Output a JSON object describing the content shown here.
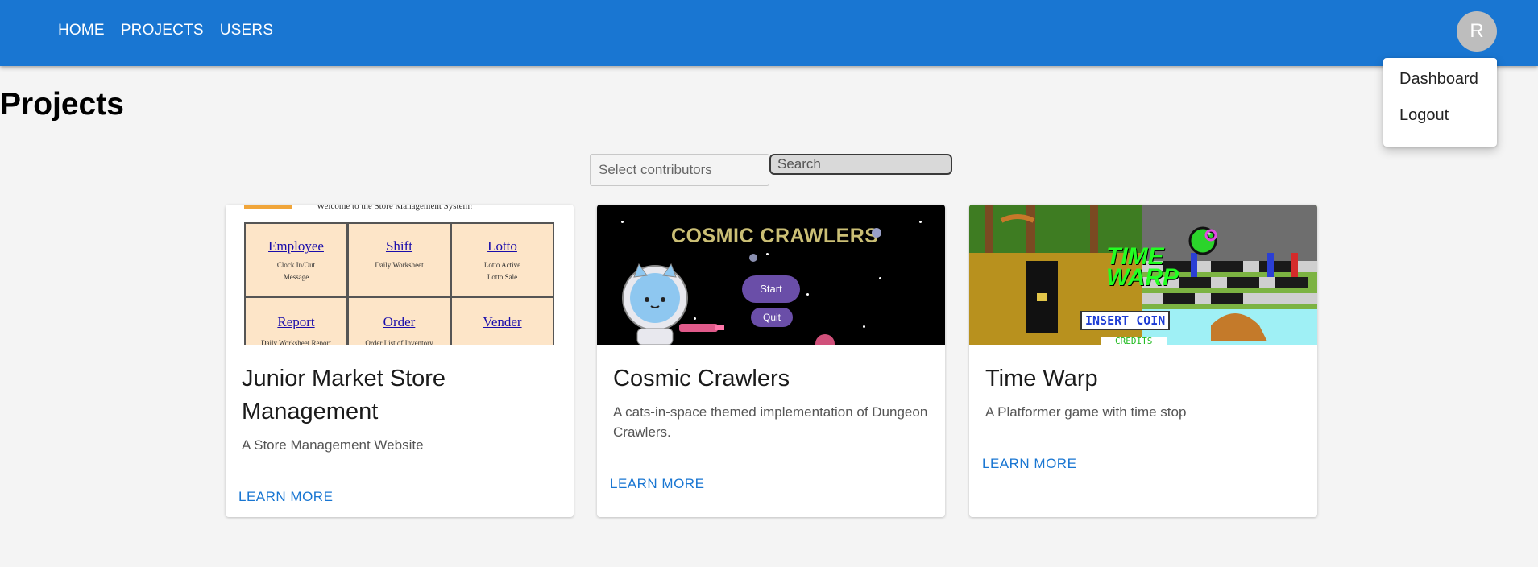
{
  "nav": {
    "home": "HOME",
    "projects": "PROJECTS",
    "users": "USERS"
  },
  "avatar_letter": "R",
  "menu": {
    "dashboard": "Dashboard",
    "logout": "Logout"
  },
  "page_title": "Projects",
  "filters": {
    "contributors_placeholder": "Select contributors",
    "search_placeholder": "Search"
  },
  "cards": [
    {
      "title": "Junior Market Store Management",
      "description": "A Store Management Website",
      "action": "LEARN MORE",
      "thumbnail": {
        "welcome": "Welcome to the Store Management System!",
        "cells": [
          {
            "link": "Employee",
            "sub1": "Clock In/Out",
            "sub2": "Message"
          },
          {
            "link": "Shift",
            "sub1": "Daily Worksheet",
            "sub2": ""
          },
          {
            "link": "Lotto",
            "sub1": "Lotto Active",
            "sub2": "Lotto Sale"
          },
          {
            "link": "Report",
            "sub1": "Daily Worksheet Report",
            "sub2": ""
          },
          {
            "link": "Order",
            "sub1": "Order List of Inventory",
            "sub2": ""
          },
          {
            "link": "Vender",
            "sub1": "",
            "sub2": ""
          }
        ]
      }
    },
    {
      "title": "Cosmic Crawlers",
      "description": "A cats-in-space themed implementation of Dungeon Crawlers.",
      "action": "LEARN MORE",
      "thumbnail": {
        "game_title": "COSMIC CRAWLERS",
        "start": "Start",
        "quit": "Quit"
      }
    },
    {
      "title": "Time Warp",
      "description": "A Platformer game with time stop",
      "action": "LEARN MORE",
      "thumbnail": {
        "logo": "TIME WARP",
        "insert_coin": "INSERT COIN",
        "credits": "CREDITS"
      }
    }
  ],
  "colors": {
    "appbar": "#1976d2",
    "link": "#1976d2",
    "avatar": "#bdbdbd"
  }
}
